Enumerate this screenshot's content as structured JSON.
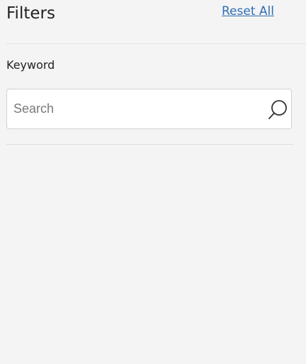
{
  "header": {
    "title": "Filters",
    "reset_label": "Reset All"
  },
  "keyword": {
    "label": "Keyword",
    "placeholder": "Search",
    "value": "",
    "icon": "search-icon"
  },
  "colors": {
    "background": "#f4f4f4",
    "link": "#2f6db5",
    "input_background": "#ffffff",
    "input_border": "#d2d2d2"
  }
}
